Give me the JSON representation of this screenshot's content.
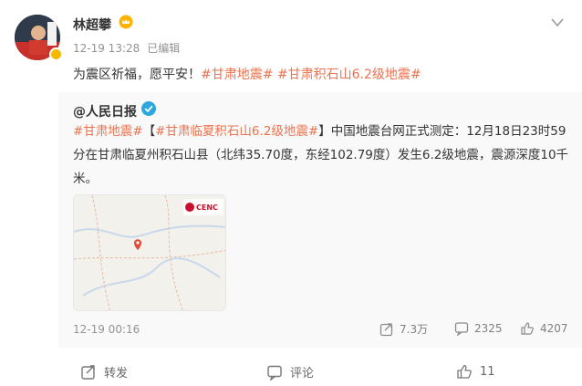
{
  "post": {
    "username": "林超攀",
    "timestamp": "12-19 13:28",
    "edited": "已编辑",
    "text_prefix": "为震区祈福，愿平安！",
    "topic1": "#甘肃地震#",
    "topic2": "#甘肃积石山6.2级地震#"
  },
  "repost": {
    "author": "@人民日报",
    "topic1": "#甘肃地震#",
    "bracket_open": "【",
    "topic2": "#甘肃临夏积石山6.2级地震#",
    "bracket_close": "】",
    "body": "中国地震台网正式测定：12月18日23时59分在甘肃临夏州积石山县（北纬35.70度，东经102.79度）发生6.2级地震，震源深度10千米。",
    "timestamp": "12-19 00:16",
    "map_logo_text": "CENC",
    "reposts": "7.3万",
    "comments": "2325",
    "likes": "4207"
  },
  "actions": {
    "repost_label": "转发",
    "comment_label": "评论",
    "like_count": "11"
  },
  "colors": {
    "topic": "#eb7350",
    "verified": "#2ea7e0",
    "muted": "#939393"
  },
  "icons": [
    "crown-icon",
    "more-chevron-icon",
    "verified-icon",
    "repost-icon",
    "comment-icon",
    "like-icon",
    "location-pin-icon"
  ]
}
